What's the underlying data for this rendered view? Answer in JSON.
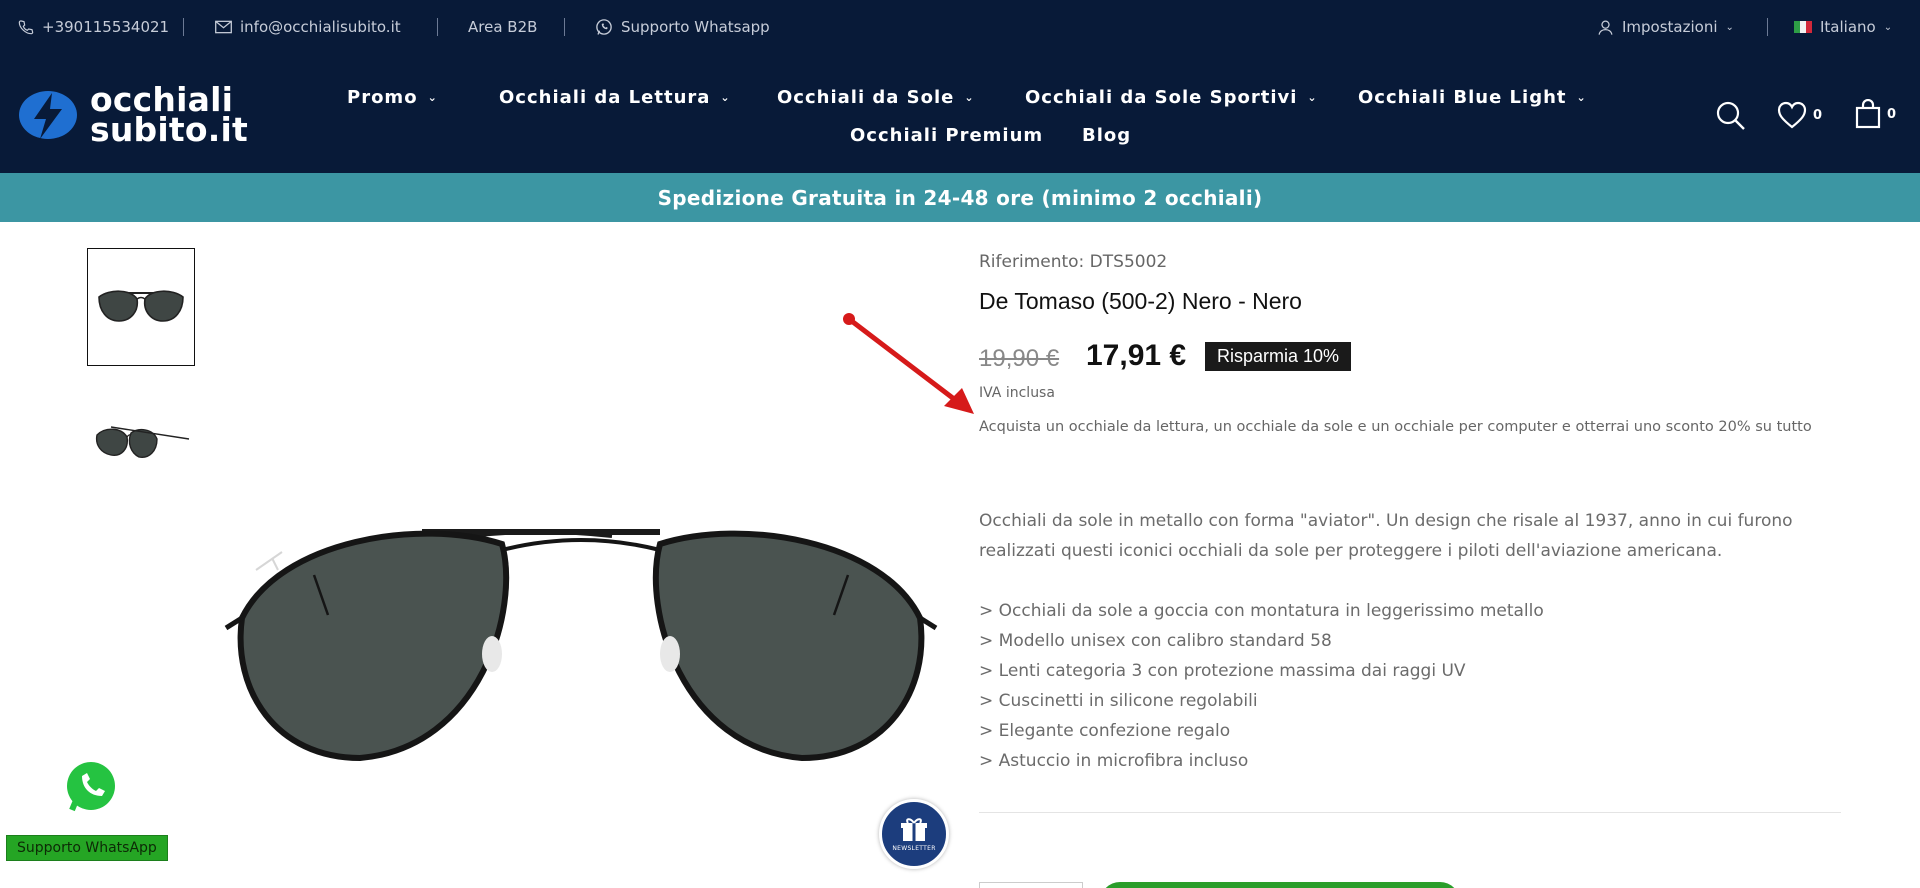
{
  "topbar": {
    "phone": "+390115534021",
    "email": "info@occhialisubito.it",
    "b2b": "Area B2B",
    "whatsapp": "Supporto Whatsapp",
    "settings": "Impostazioni",
    "language": "Italiano"
  },
  "logo": {
    "line1": "occhiali",
    "line2": "subito.it"
  },
  "nav": {
    "promo": "Promo",
    "reading": "Occhiali da Lettura",
    "sun": "Occhiali da Sole",
    "sport": "Occhiali da Sole Sportivi",
    "bluelight": "Occhiali Blue Light",
    "premium": "Occhiali Premium",
    "blog": "Blog"
  },
  "header_counts": {
    "wishlist": "0",
    "cart": "0"
  },
  "promo_banner": "Spedizione Gratuita in 24-48 ore (minimo 2 occhiali)",
  "product": {
    "reference": "Riferimento: DTS5002",
    "title": "De Tomaso (500-2) Nero - Nero",
    "old_price": "19,90 €",
    "new_price": "17,91 €",
    "discount": "Risparmia 10%",
    "vat": "IVA inclusa",
    "offer": "Acquista un occhiale da lettura, un occhiale da sole e un occhiale per computer e otterrai uno sconto 20% su tutto",
    "description": "Occhiali da sole in metallo con forma \"aviator\". Un design che risale al 1937, anno in cui furono realizzati questi iconici occhiali da sole per proteggere i piloti dell'aviazione americana.",
    "features": [
      "> Occhiali da sole a goccia con montatura in leggerissimo metallo",
      "> Modello unisex con calibro standard 58",
      "> Lenti categoria 3 con protezione massima dai raggi UV",
      "> Cuscinetti in silicone regolabili",
      "> Elegante confezione regalo",
      "> Astuccio in microfibra incluso"
    ]
  },
  "widgets": {
    "whatsapp_label": "Supporto WhatsApp",
    "newsletter": "NEWSLETTER"
  },
  "colors": {
    "header_bg": "#081a38",
    "promo_bg": "#3c96a3",
    "whatsapp": "#25a524",
    "annotation_arrow": "#d61a1a"
  }
}
